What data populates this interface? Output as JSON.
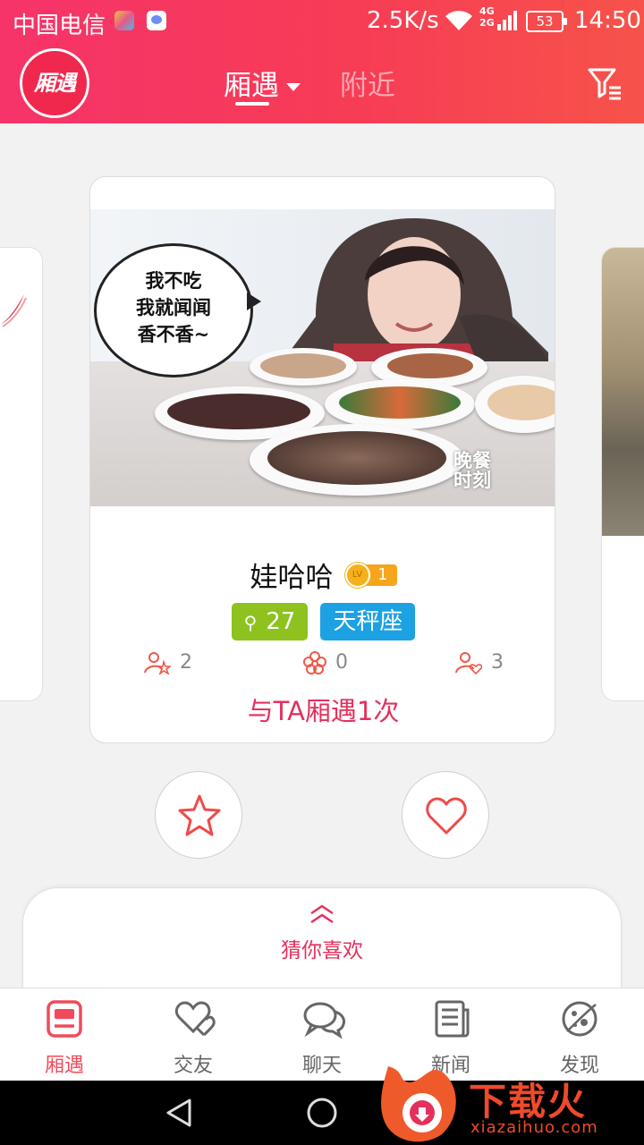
{
  "status_bar": {
    "carrier": "中国电信",
    "speed": "2.5K/s",
    "network": "4G\n2G",
    "battery": "53",
    "time": "14:50"
  },
  "header": {
    "logo_text": "厢遇",
    "tab_main": "厢遇",
    "tab_near": "附近"
  },
  "card": {
    "bubble_lines": [
      "我不吃",
      "我就闻闻",
      "香不香~"
    ],
    "stamp_text": [
      "晚餐",
      "时刻"
    ],
    "name": "娃哈哈",
    "level_prefix": "LV",
    "level": "1",
    "age": "27",
    "age_symbol": "⚲",
    "constellation": "天秤座",
    "stat_visitors": "2",
    "stat_flowers": "0",
    "stat_likes": "3",
    "meet_text": "与TA厢遇1次"
  },
  "guess": {
    "label": "猜你喜欢"
  },
  "nav": {
    "items": [
      {
        "label": "厢遇",
        "icon": "train-icon"
      },
      {
        "label": "交友",
        "icon": "hearts-icon"
      },
      {
        "label": "聊天",
        "icon": "chat-bubbles-icon"
      },
      {
        "label": "新闻",
        "icon": "news-icon"
      },
      {
        "label": "发现",
        "icon": "planet-icon"
      }
    ],
    "active_color": "#f24a5a"
  },
  "watermark": {
    "text": "下载火",
    "sub": "xiazaihuo.com"
  },
  "colors": {
    "brand": "#f6336a",
    "accent_pink": "#e5305c",
    "age_badge": "#8dc21f",
    "sign_badge": "#1ca1e2",
    "level": "#f6a51c"
  }
}
